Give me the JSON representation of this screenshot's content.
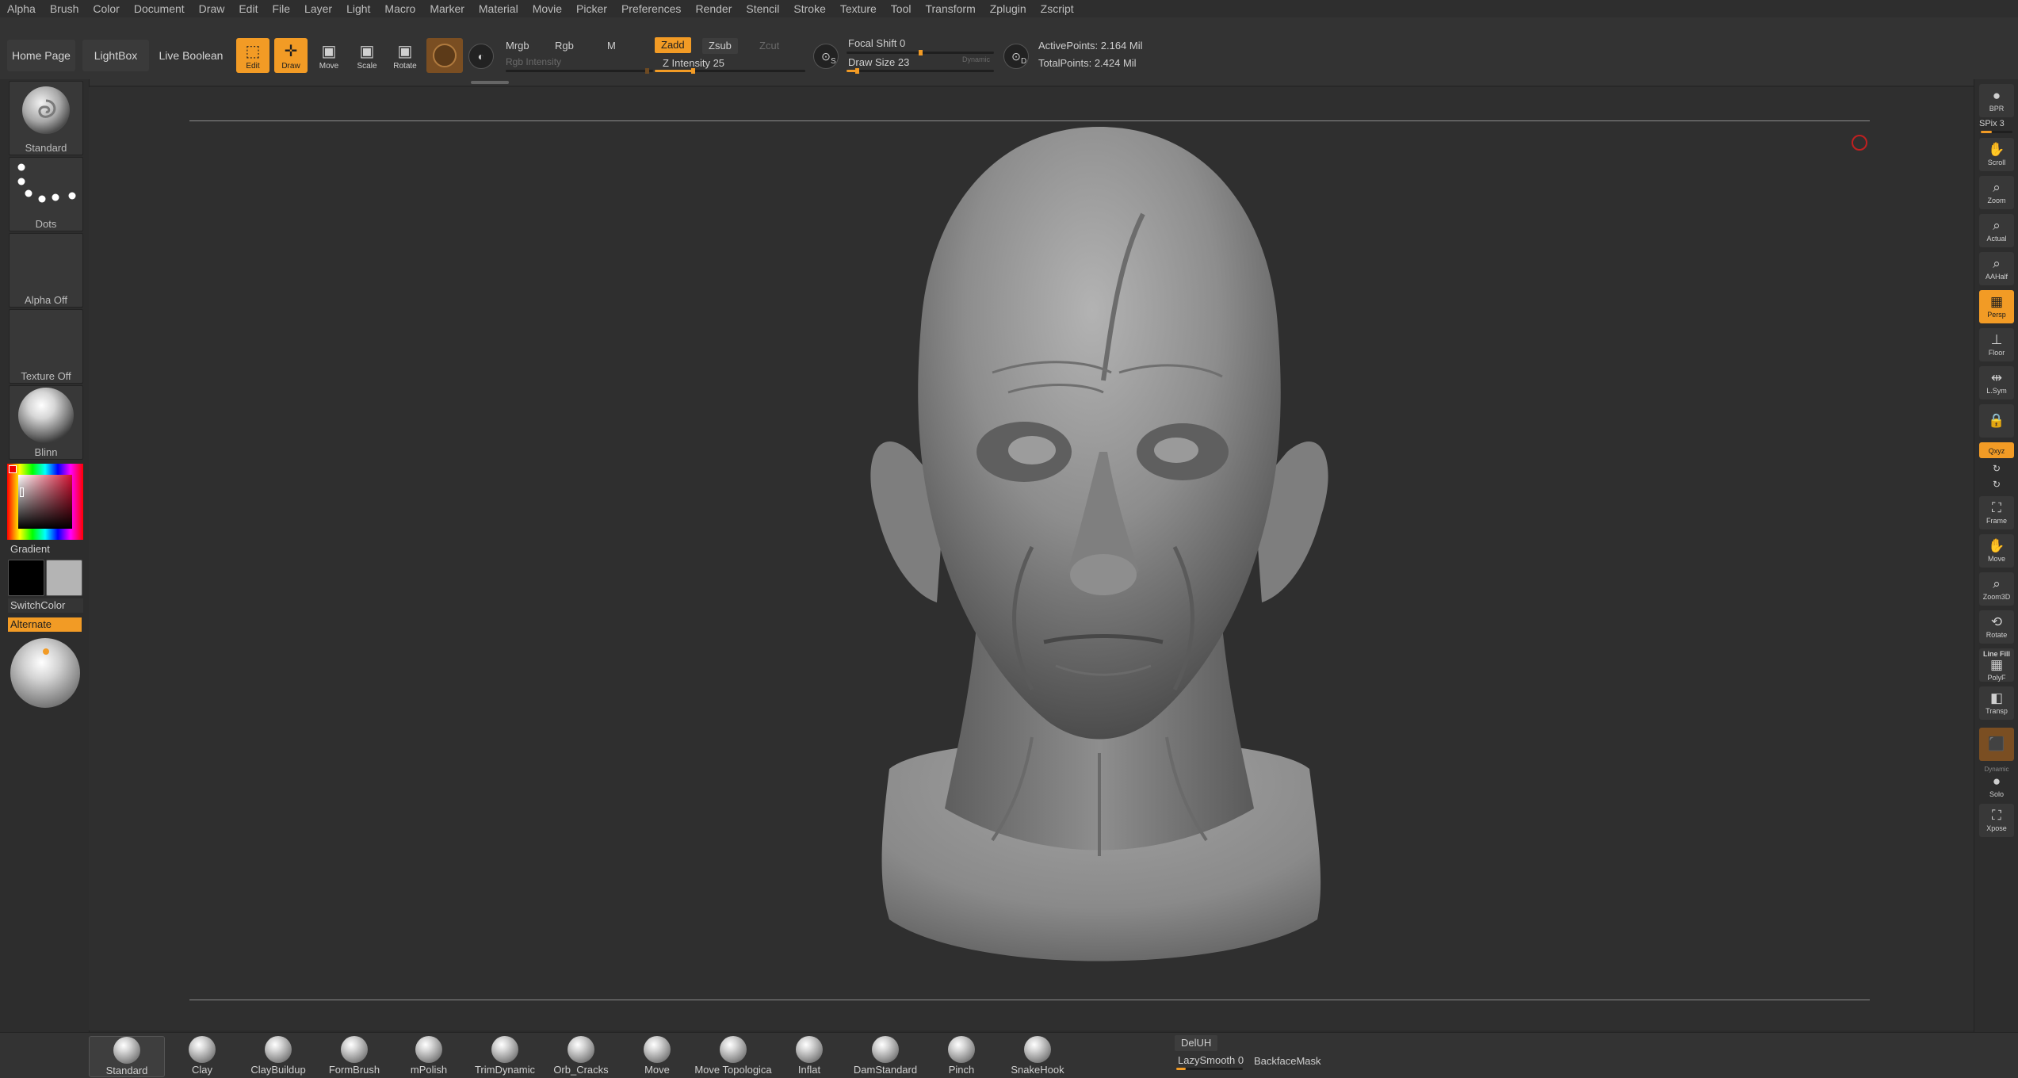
{
  "menu": [
    "Alpha",
    "Brush",
    "Color",
    "Document",
    "Draw",
    "Edit",
    "File",
    "Layer",
    "Light",
    "Macro",
    "Marker",
    "Material",
    "Movie",
    "Picker",
    "Preferences",
    "Render",
    "Stencil",
    "Stroke",
    "Texture",
    "Tool",
    "Transform",
    "Zplugin",
    "Zscript"
  ],
  "shelf": {
    "home_page": "Home Page",
    "lightbox": "LightBox",
    "live_boolean": "Live Boolean",
    "edit": "Edit",
    "draw": "Draw",
    "move": "Move",
    "scale": "Scale",
    "rotate": "Rotate",
    "mrgb": "Mrgb",
    "rgb": "Rgb",
    "m": "M",
    "rgb_intensity": "Rgb Intensity",
    "zadd": "Zadd",
    "zsub": "Zsub",
    "zcut": "Zcut",
    "z_intensity": "Z Intensity 25",
    "z_intensity_value": 25,
    "focal_shift": "Focal Shift 0",
    "focal_shift_value": 0,
    "draw_size": "Draw Size 23",
    "draw_size_value": 23,
    "dynamic": "Dynamic",
    "s_label": "S",
    "d_label": "D",
    "active_points": "ActivePoints: 2.164 Mil",
    "total_points": "TotalPoints: 2.424 Mil"
  },
  "left": {
    "brush": "Standard",
    "stroke": "Dots",
    "alpha": "Alpha Off",
    "texture": "Texture Off",
    "material": "Blinn",
    "gradient": "Gradient",
    "switch_color": "SwitchColor",
    "alternate": "Alternate"
  },
  "right": {
    "bpr": "BPR",
    "spix": "SPix 3",
    "scroll": "Scroll",
    "zoom": "Zoom",
    "actual": "Actual",
    "aahalf": "AAHalf",
    "persp": "Persp",
    "floor": "Floor",
    "lsym": "L.Sym",
    "xyz": "Qxyz",
    "frame": "Frame",
    "move": "Move",
    "zoom3d": "Zoom3D",
    "rotate": "Rotate",
    "line_fill": "Line Fill",
    "polyf": "PolyF",
    "transp": "Transp",
    "solo": "Solo",
    "dynamic": "Dynamic",
    "xpose": "Xpose"
  },
  "brushes": [
    "Standard",
    "Clay",
    "ClayBuildup",
    "FormBrush",
    "mPolish",
    "TrimDynamic",
    "Orb_Cracks",
    "Move",
    "Move Topologica",
    "Inflat",
    "DamStandard",
    "Pinch",
    "SnakeHook"
  ],
  "bottom": {
    "deluh": "DelUH",
    "lazy_smooth": "LazySmooth 0",
    "backface_mask": "BackfaceMask"
  },
  "colors": {
    "accent": "#f29b25",
    "canvas": "#2f2f2f",
    "panel": "#333333"
  }
}
